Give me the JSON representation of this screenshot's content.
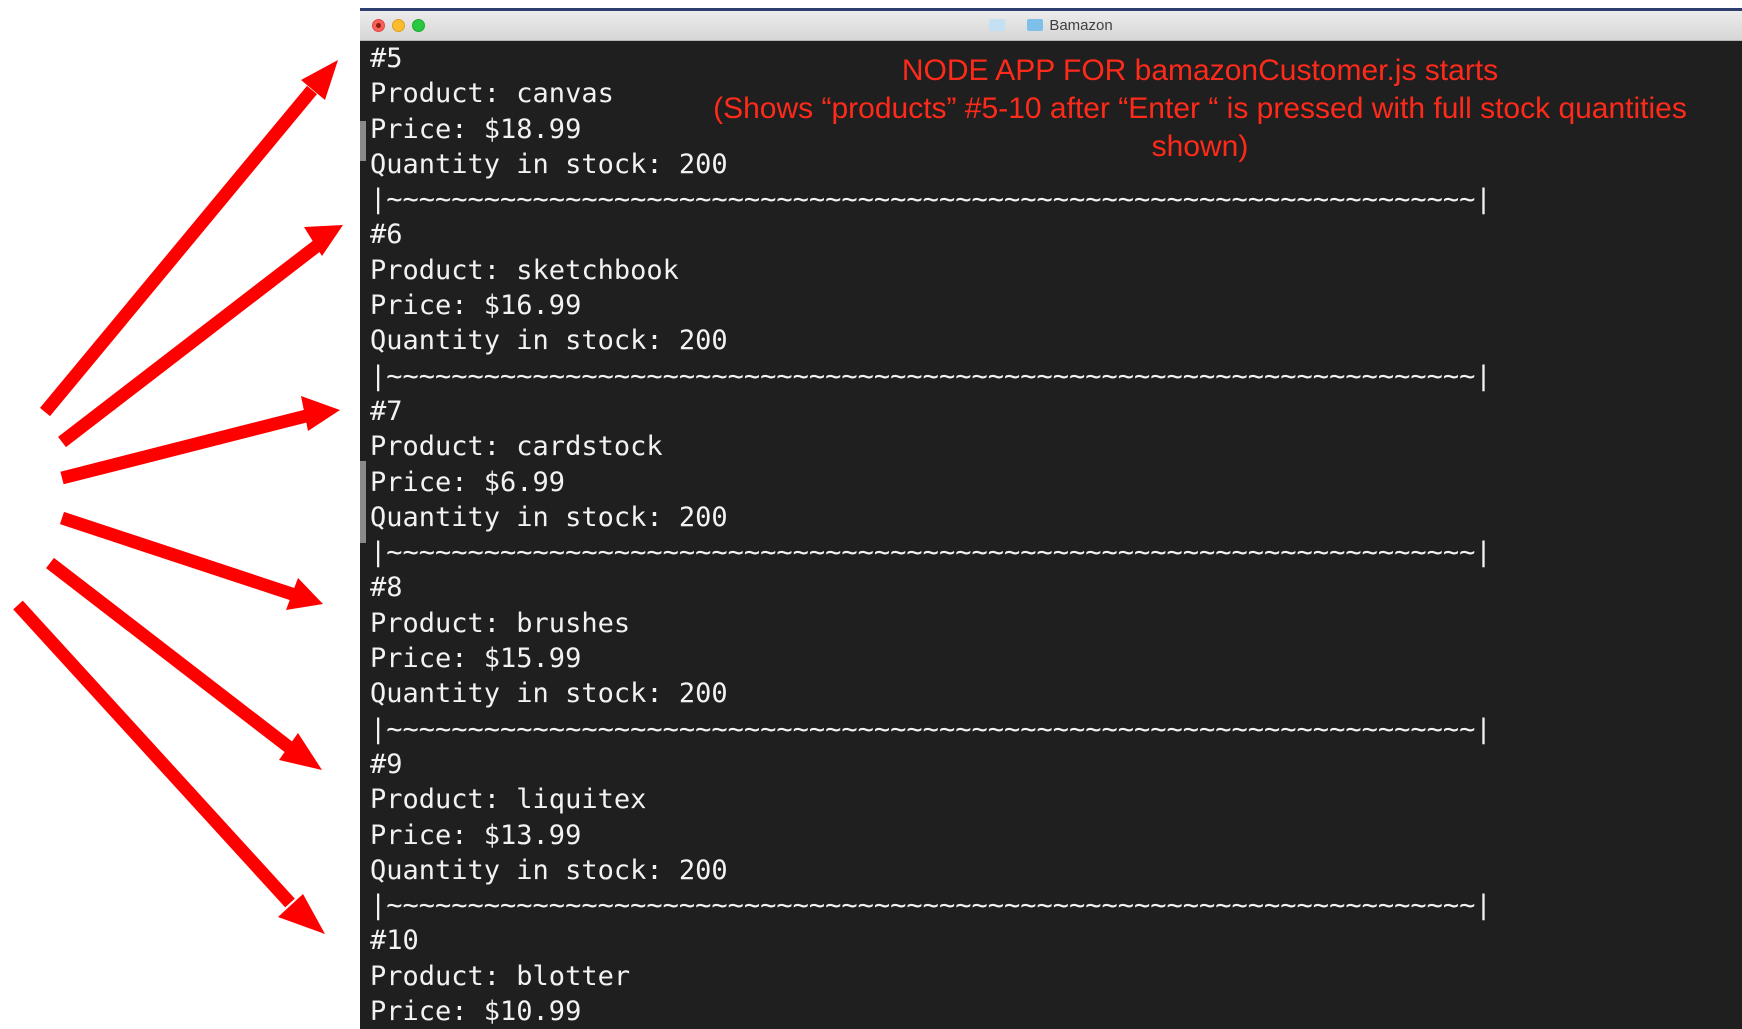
{
  "window": {
    "title": "Bamazon"
  },
  "annotation": {
    "line1": "NODE APP FOR bamazonCustomer.js starts",
    "line2": "(Shows “products” #5-10 after “Enter “ is pressed with full stock quantities",
    "line3": "shown)",
    "color": "#ff2a1a"
  },
  "terminal": {
    "lines": [
      "#5",
      "Product: canvas",
      "Price: $18.99",
      "Quantity in stock: 200",
      "|~~~~~~~~~~~~~~~~~~~~~~~~~~~~~~~~~~~~~~~~~~~~~~~~~~~~~~~~~~~~~~~~~~~|",
      "#6",
      "Product: sketchbook",
      "Price: $16.99",
      "Quantity in stock: 200",
      "|~~~~~~~~~~~~~~~~~~~~~~~~~~~~~~~~~~~~~~~~~~~~~~~~~~~~~~~~~~~~~~~~~~~|",
      "#7",
      "Product: cardstock",
      "Price: $6.99",
      "Quantity in stock: 200",
      "|~~~~~~~~~~~~~~~~~~~~~~~~~~~~~~~~~~~~~~~~~~~~~~~~~~~~~~~~~~~~~~~~~~~|",
      "#8",
      "Product: brushes",
      "Price: $15.99",
      "Quantity in stock: 200",
      "|~~~~~~~~~~~~~~~~~~~~~~~~~~~~~~~~~~~~~~~~~~~~~~~~~~~~~~~~~~~~~~~~~~~|",
      "#9",
      "Product: liquitex",
      "Price: $13.99",
      "Quantity in stock: 200",
      "|~~~~~~~~~~~~~~~~~~~~~~~~~~~~~~~~~~~~~~~~~~~~~~~~~~~~~~~~~~~~~~~~~~~|",
      "#10",
      "Product: blotter",
      "Price: $10.99"
    ]
  },
  "colors": {
    "terminal_bg": "#1f1f1f",
    "terminal_text": "#f2f2f2",
    "arrow": "#ff0000"
  },
  "icons": {
    "title_folder": "folder-icon",
    "arrows": "red-arrow-icon"
  }
}
